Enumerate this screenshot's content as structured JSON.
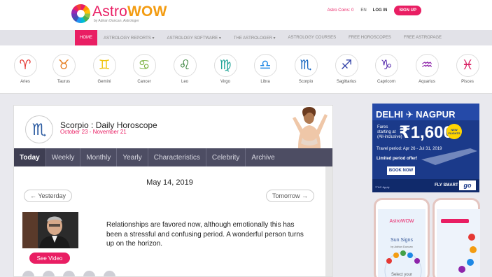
{
  "header": {
    "logo_astro": "Astro",
    "logo_wow": "WOW",
    "logo_tagline": "by Adrian Duncan, Astrologer",
    "coins_label": "Astro Coins: 0",
    "lang": "EN",
    "login": "LOG IN",
    "signup": "SIGN UP"
  },
  "nav": {
    "items": [
      "HOME",
      "ASTROLOGY REPORTS ▾",
      "ASTROLOGY SOFTWARE ▾",
      "THE ASTROLOGER ▾",
      "ASTROLOGY COURSES",
      "FREE HOROSCOPES",
      "FREE ASTROPAGE"
    ]
  },
  "zodiac": [
    {
      "glyph": "♈",
      "label": "Aries"
    },
    {
      "glyph": "♉",
      "label": "Taurus"
    },
    {
      "glyph": "♊",
      "label": "Gemini"
    },
    {
      "glyph": "♋",
      "label": "Cancer"
    },
    {
      "glyph": "♌",
      "label": "Leo"
    },
    {
      "glyph": "♍",
      "label": "Virgo"
    },
    {
      "glyph": "♎",
      "label": "Libra"
    },
    {
      "glyph": "♏",
      "label": "Scorpio"
    },
    {
      "glyph": "♐",
      "label": "Sagittarius"
    },
    {
      "glyph": "♑",
      "label": "Capricorn"
    },
    {
      "glyph": "♒",
      "label": "Aquarius"
    },
    {
      "glyph": "♓",
      "label": "Pisces"
    }
  ],
  "horoscope": {
    "glyph": "♏",
    "title": "Scorpio : Daily Horoscope",
    "dates": "October 23 - November 21",
    "tabs": [
      "Today",
      "Weekly",
      "Monthly",
      "Yearly",
      "Characteristics",
      "Celebrity",
      "Archive"
    ],
    "date": "May 14, 2019",
    "prev_label": "←  Yesterday",
    "next_label": "Tomorrow  →",
    "see_video": "See Video",
    "reading": "Relationships are favored now, although emotionally this has been a stressful and confusing period. A wonderful person turns up on the horizon."
  },
  "ad": {
    "route": "DELHI ✈ NAGPUR",
    "fares_line1": "Fares",
    "fares_line2": "starting at",
    "fares_line3": "(All-inclusive)",
    "price": "₹1,600*",
    "badge": "NEW FLIGHTS",
    "period": "Travel period: Apr 26 - Jul 31, 2019",
    "offer": "Limited period offer!",
    "book": "BOOK NOW",
    "tc": "*T&C Apply",
    "brand": "FLY SMART",
    "brand_logo": "go"
  },
  "phone": {
    "app_name": "AstroWOW",
    "heading": "Sun Signs",
    "sub": "by Adrian Duncan",
    "select": "Select your"
  },
  "colors": {
    "accent": "#e91e63",
    "nav_bg": "#e2e2e8",
    "tabs_bg": "#4d4d63",
    "ad_bg": "#1b3a8a",
    "zodiac_fill": "#7b3fa0"
  }
}
